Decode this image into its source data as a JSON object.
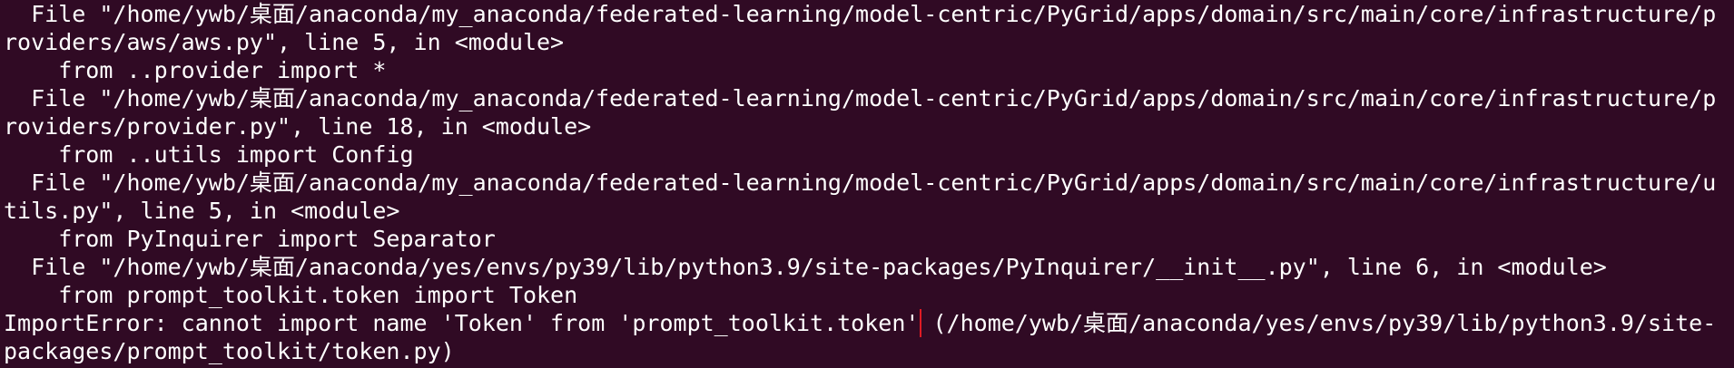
{
  "terminal": {
    "lines": [
      "  File \"/home/ywb/桌面/anaconda/my_anaconda/federated-learning/model-centric/PyGrid/apps/domain/src/main/core/infrastructure/p",
      "roviders/aws/aws.py\", line 5, in <module>",
      "    from ..provider import *",
      "  File \"/home/ywb/桌面/anaconda/my_anaconda/federated-learning/model-centric/PyGrid/apps/domain/src/main/core/infrastructure/p",
      "roviders/provider.py\", line 18, in <module>",
      "    from ..utils import Config",
      "  File \"/home/ywb/桌面/anaconda/my_anaconda/federated-learning/model-centric/PyGrid/apps/domain/src/main/core/infrastructure/u",
      "tils.py\", line 5, in <module>",
      "    from PyInquirer import Separator",
      "  File \"/home/ywb/桌面/anaconda/yes/envs/py39/lib/python3.9/site-packages/PyInquirer/__init__.py\", line 6, in <module>",
      "    from prompt_toolkit.token import Token"
    ],
    "error_highlight": "ImportError: cannot import name 'Token' from 'prompt_toolkit.token'",
    "error_rest": " (/home/ywb/桌面/anaconda/yes/envs/py39/lib/python3.9/site-",
    "error_continuation": "packages/prompt_toolkit/token.py)",
    "colors": {
      "background": "#300a24",
      "text": "#ffffff",
      "highlight_border": "#e01b24"
    }
  }
}
